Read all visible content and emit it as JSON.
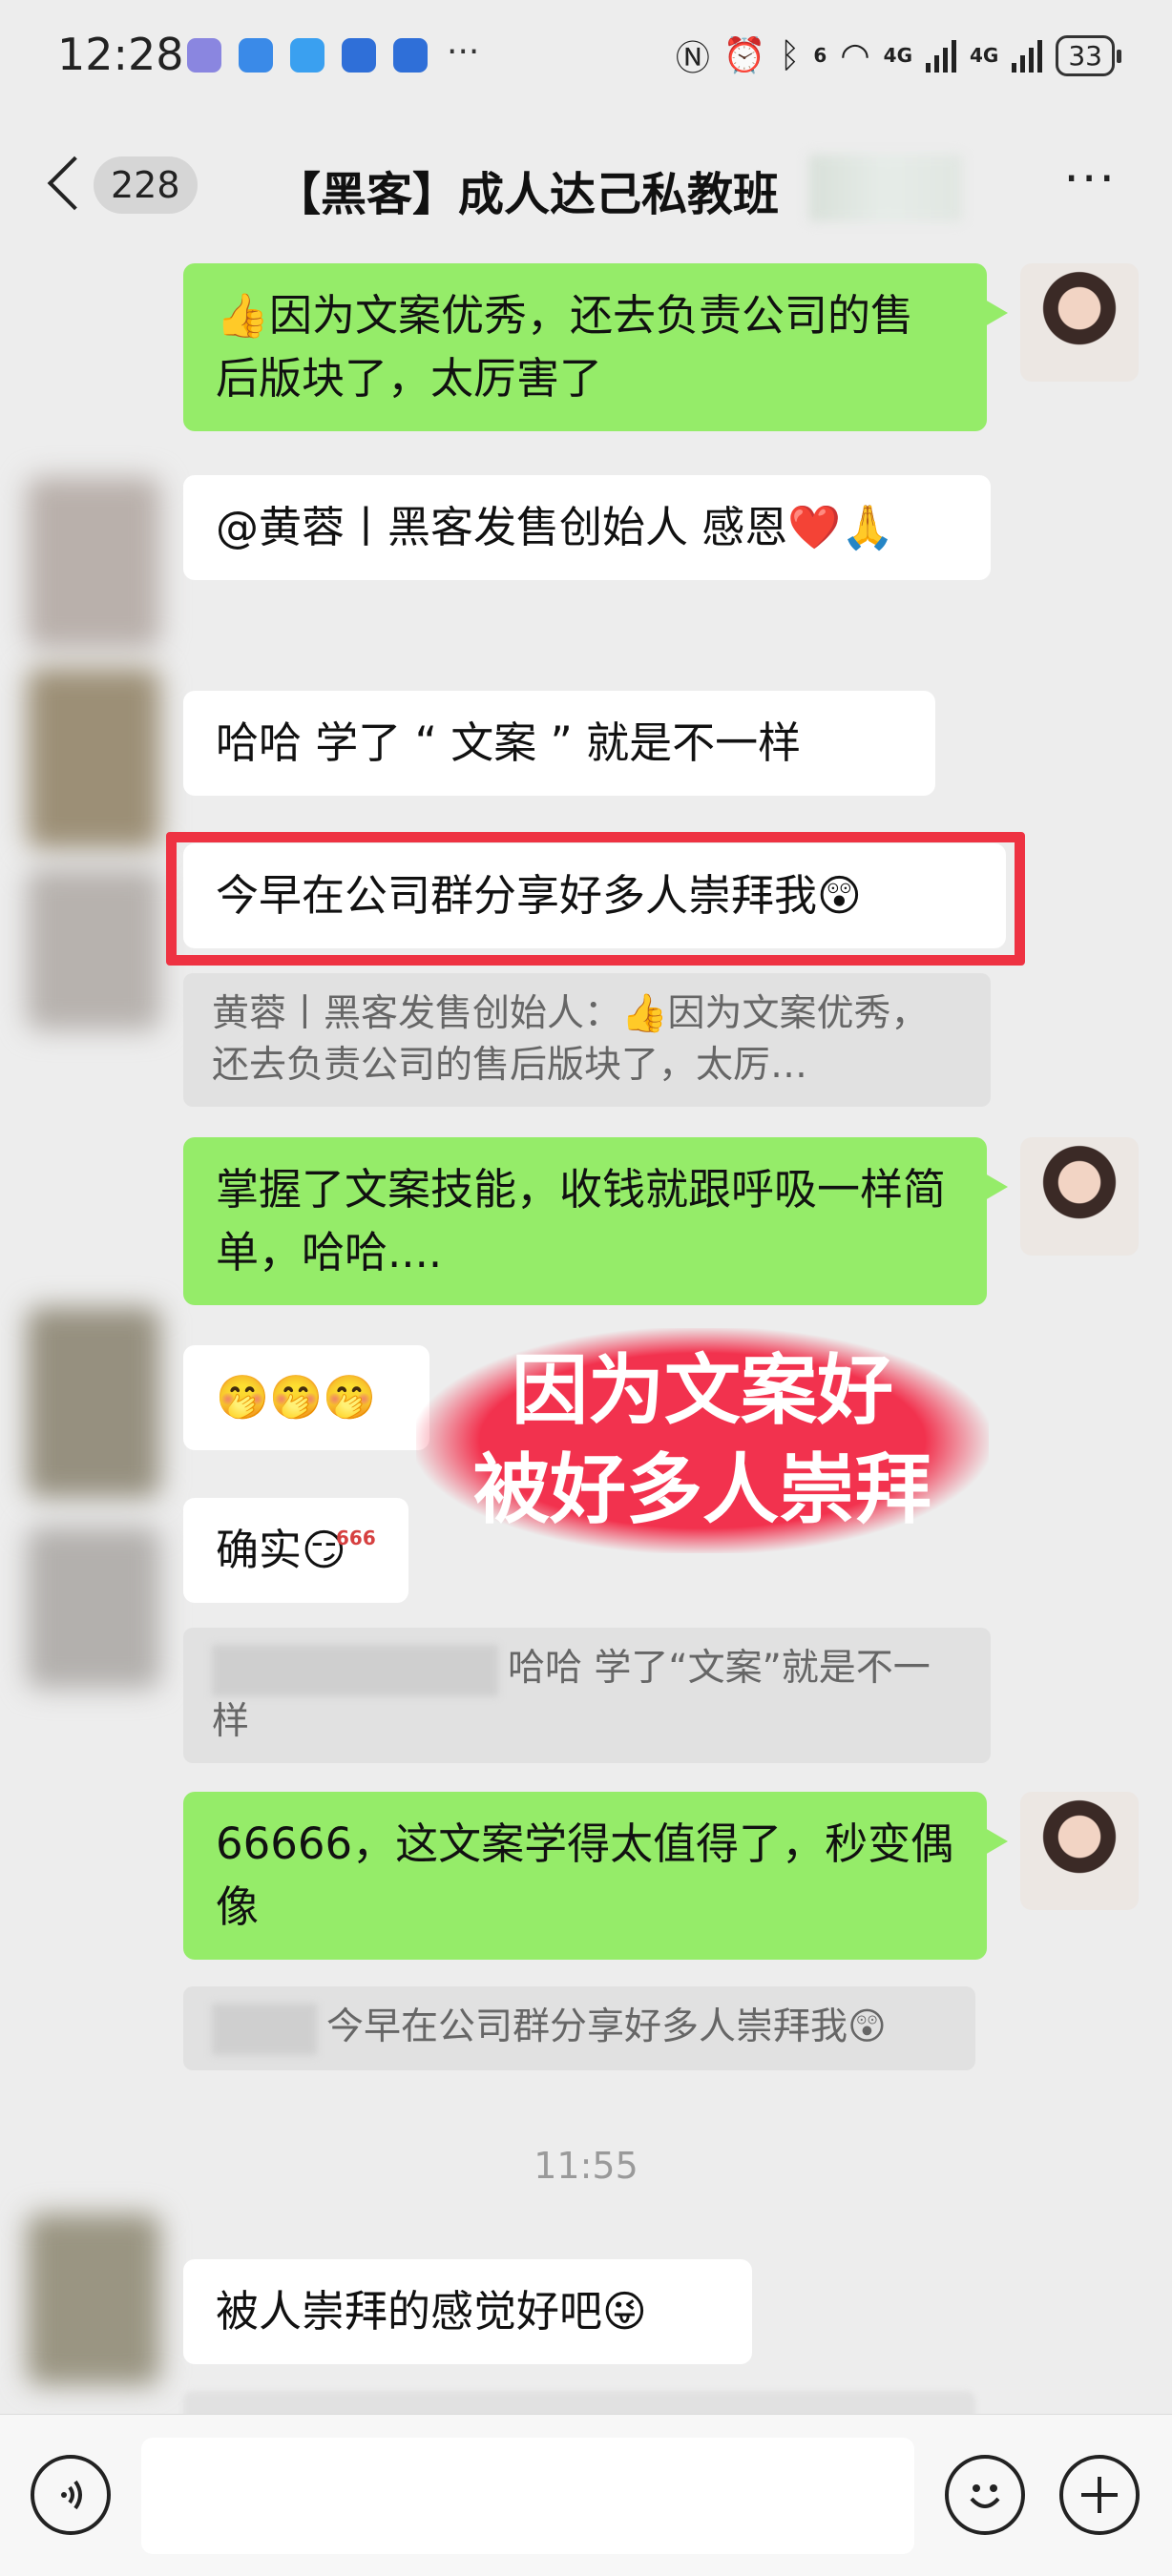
{
  "status_bar": {
    "time": "12:28",
    "overflow": "···",
    "network_1": "6",
    "network_2": "4G",
    "network_3": "4G",
    "battery": "33",
    "icons": [
      "nfc-icon",
      "alarm-icon",
      "bluetooth-icon",
      "wifi-icon",
      "signal-icon",
      "signal-icon"
    ]
  },
  "header": {
    "back_icon": "chevron-left-icon",
    "unread_count": "228",
    "title": "【黑客】成人达己私教班",
    "more_icon": "more-dots-icon"
  },
  "messages": [
    {
      "side": "right",
      "text": "👍因为文案优秀，还去负责公司的售后版块了，太厉害了"
    },
    {
      "side": "left",
      "text": "@黄蓉丨黑客发售创始人  感恩❤️🙏"
    },
    {
      "side": "left",
      "text": "哈哈 学了 “ 文案 ” 就是不一样"
    },
    {
      "side": "left",
      "text": "今早在公司群分享好多人崇拜我😲",
      "quote": "黄蓉丨黑客发售创始人：👍因为文案优秀，还去负责公司的售后版块了，太厉…"
    },
    {
      "side": "right",
      "text": "掌握了文案技能，收钱就跟呼吸一样简单，哈哈...."
    },
    {
      "side": "left",
      "text": "🤭🤭🤭"
    },
    {
      "side": "left",
      "text": "确实😏",
      "quote": "哈哈 学了“文案”就是不一样"
    },
    {
      "side": "right",
      "text": "66666，这文案学得太值得了，秒变偶像",
      "quote": "今早在公司群分享好多人崇拜我😲"
    },
    {
      "side": "left",
      "text": "被人崇拜的感觉好吧😜"
    }
  ],
  "overlay": {
    "line1": "因为文案好",
    "line2": "被好多人崇拜"
  },
  "timestamp": "11:55",
  "badge_666": "666",
  "input_bar": {
    "voice_icon": "voice-icon",
    "emoji_icon": "emoji-icon",
    "add_icon": "plus-icon"
  },
  "colors": {
    "background": "#ededed",
    "outgoing_bubble": "#95ec69",
    "incoming_bubble": "#ffffff",
    "highlight": "#ee3242",
    "overlay": "#f2324e"
  }
}
